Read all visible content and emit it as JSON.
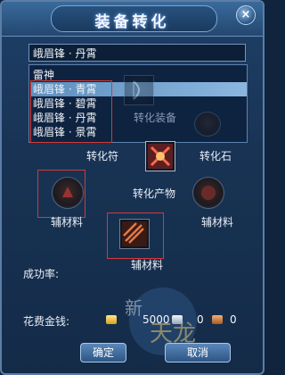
{
  "window": {
    "title": "装备转化",
    "close_glyph": "×"
  },
  "selected_item": "峨眉锋 · 丹霄",
  "list": {
    "items": [
      "雷神",
      "峨眉锋 · 青霄",
      "峨眉锋 · 碧霄",
      "峨眉锋 · 丹霄",
      "峨眉锋 · 景霄"
    ],
    "highlighted_index": 1
  },
  "slots": {
    "convert_equip_label": "转化装备",
    "convert_charm_label": "转化符",
    "convert_stone_label": "转化石",
    "convert_product_label": "转化产物",
    "aux_material_label_1": "辅材料",
    "aux_material_label_2": "辅材料",
    "aux_material_label_3": "辅材料"
  },
  "success_rate_label": "成功率:",
  "cost": {
    "label": "花费金钱:",
    "gold": "5000",
    "silver": "0",
    "copper": "0"
  },
  "buttons": {
    "confirm": "确定",
    "cancel": "取消"
  },
  "logo_text": "新 天龙八部",
  "colors": {
    "highlight": "#8bb7df",
    "red_box": "#d03a3a",
    "panel": "#183354"
  },
  "icons": [
    "close-icon",
    "bow-item-icon",
    "rune-icon",
    "stone-icon",
    "scroll-icon",
    "material-icon",
    "gold-coin-icon",
    "silver-coin-icon",
    "copper-coin-icon"
  ]
}
